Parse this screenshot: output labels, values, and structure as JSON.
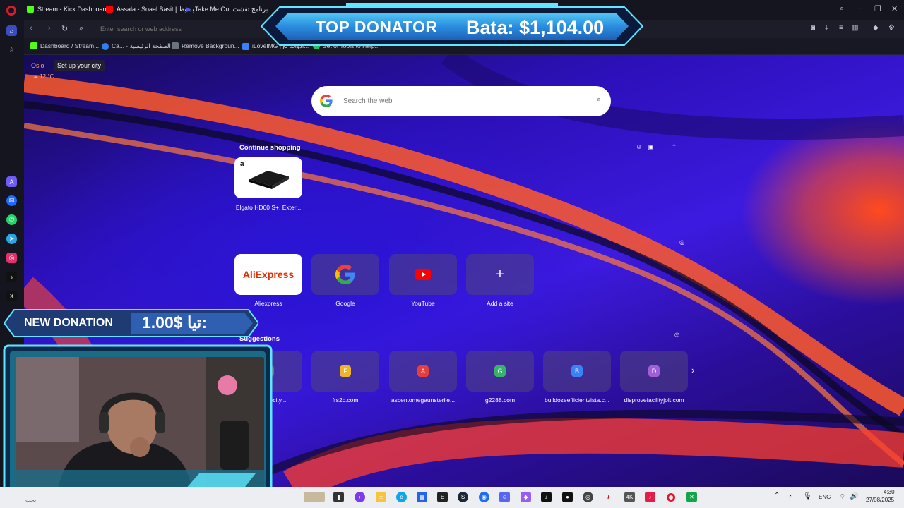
{
  "tabs": [
    {
      "label": "Stream - Kick Dashboard",
      "color": "#53fc18"
    },
    {
      "label": "Assala - Soaal Basit | بسيط",
      "color": "#ff0000"
    },
    {
      "label": "Take Me Out برنامج تقشت",
      "color": "#4f5bd5"
    }
  ],
  "address_bar": {
    "placeholder": "Enter search or web address"
  },
  "bookmarks": [
    {
      "label": "Dashboard / Stream...",
      "color": "#53fc18"
    },
    {
      "label": "Ca... - الصفحة الرئيسية",
      "color": "#2f80ed"
    },
    {
      "label": "Remove Backgroun...",
      "color": "#6b7280"
    },
    {
      "label": "iLoveIMG | أدوات نع...",
      "color": "#3b82f6"
    },
    {
      "label": "Set of Tools to Help...",
      "color": "#22c55e"
    }
  ],
  "weather": {
    "city": "Oslo",
    "setup_label": "Set up your city",
    "temp": "12 °C"
  },
  "search": {
    "placeholder": "Search the web"
  },
  "continue_shopping": {
    "label": "Continue shopping",
    "items": [
      {
        "caption": "Elgato HD60 S+, Exter...",
        "badge": "a"
      }
    ]
  },
  "speed_dial": [
    {
      "label": "Aliexpress",
      "logo_text": "AliExpress",
      "icon": "aliexpress-logo"
    },
    {
      "label": "Google",
      "icon": "google-logo"
    },
    {
      "label": "YouTube",
      "icon": "youtube-logo"
    },
    {
      "label": "Add a site",
      "icon": "plus-icon",
      "glyph": "+"
    }
  ],
  "suggestions": {
    "label": "Suggestions",
    "items": [
      {
        "letter": "L",
        "caption": "...letvelocity...",
        "color": "#6b7280"
      },
      {
        "letter": "F",
        "caption": "frs2c.com",
        "color": "#f0b429"
      },
      {
        "letter": "A",
        "caption": "ascentomegaunsterile...",
        "color": "#e53e3e"
      },
      {
        "letter": "G",
        "caption": "g2288.com",
        "color": "#38b26c"
      },
      {
        "letter": "B",
        "caption": "bulldozeefficientvista.c...",
        "color": "#3b82f6"
      },
      {
        "letter": "D",
        "caption": "disprovefacilityjolt.com",
        "color": "#9f5fd6"
      }
    ],
    "next_glyph": "›"
  },
  "overlay": {
    "top_donator_title": "TOP DONATOR",
    "top_donator_value": "Bata: $1,104.00",
    "new_donation_title": "NEW DONATION",
    "new_donation_value": "1.00$ تيا:"
  },
  "taskbar": {
    "language": "ENG",
    "time": "4:30",
    "date": "27/08/2025",
    "search_hint": "بحث"
  },
  "colors": {
    "accent": "#e0192a",
    "taskbar": "#eceef2",
    "kick_green": "#53fc18"
  }
}
